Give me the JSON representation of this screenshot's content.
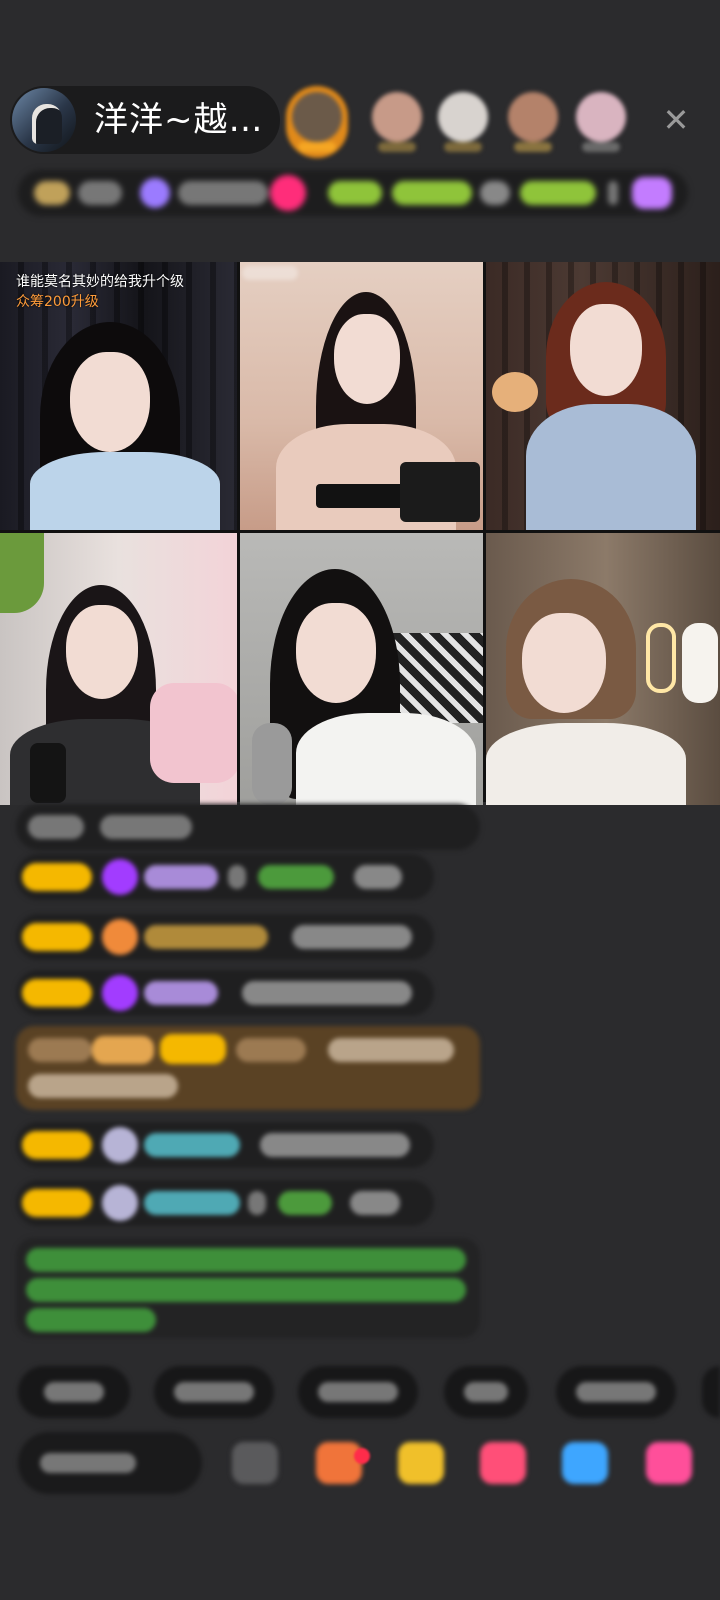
{
  "header": {
    "host_name": "洋洋~越…",
    "close_icon": "close-icon"
  },
  "grid": {
    "tile1_caption": "谁能莫名其妙的给我升个级",
    "tile1_sub": "众筹200升级"
  },
  "colors": {
    "background": "#2b2b2d",
    "badge_yellow": "#f5b800",
    "accent_orange": "#ff9c3a"
  }
}
